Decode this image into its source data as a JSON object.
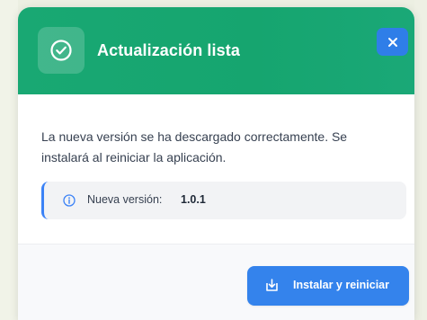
{
  "dialog": {
    "title": "Actualización lista",
    "close_label": "×",
    "message": "La nueva versión se ha descargado correctamente. Se instalará al reiniciar la aplicación.",
    "version_label": "Nueva versión:",
    "version_value": "1.0.1",
    "install_button_label": "Instalar y reiniciar"
  },
  "icons": {
    "header": "check-circle-icon",
    "close": "close-icon",
    "info": "info-icon",
    "install": "download-install-icon"
  },
  "colors": {
    "header_bg": "#19a873",
    "accent_blue": "#3483ec",
    "close_button_bg": "#2f7ee8",
    "version_border": "#3b82f6",
    "body_text": "#374151",
    "footer_bg": "#f8f9fb"
  }
}
